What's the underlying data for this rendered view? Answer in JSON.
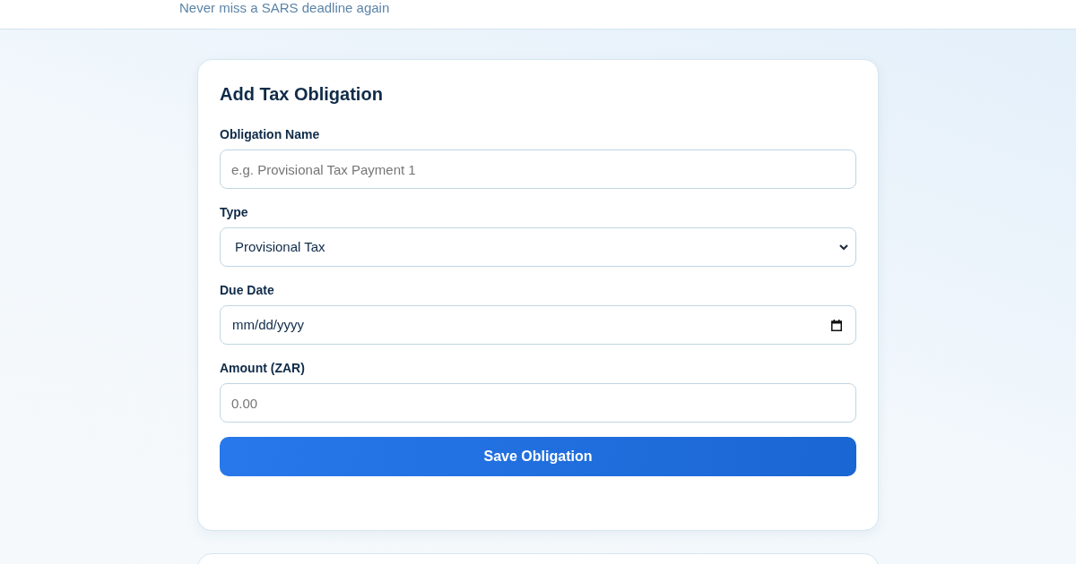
{
  "header": {
    "tagline": "Never miss a SARS deadline again"
  },
  "form": {
    "title": "Add Tax Obligation",
    "fields": [
      {
        "kind": "text",
        "label": "Obligation Name",
        "placeholder": "e.g. Provisional Tax Payment 1"
      },
      {
        "kind": "select",
        "label": "Type",
        "value": "Provisional Tax"
      },
      {
        "kind": "date",
        "label": "Due Date",
        "placeholder": "mm/dd/yyyy"
      },
      {
        "kind": "number",
        "label": "Amount (ZAR)",
        "placeholder": "0.00"
      }
    ],
    "submit": "Save Obligation"
  }
}
